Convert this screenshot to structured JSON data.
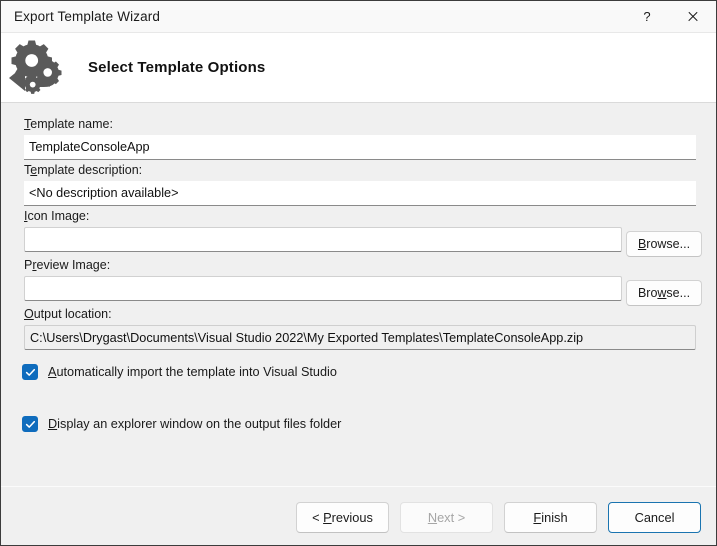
{
  "window": {
    "title": "Export Template Wizard",
    "help_button": "?",
    "close_button": "✕"
  },
  "header": {
    "icon": "export-template-gears-icon",
    "title": "Select Template Options"
  },
  "form": {
    "template_name": {
      "label_pre": "",
      "label_accel": "T",
      "label_post": "emplate name:",
      "value": "TemplateConsoleApp"
    },
    "template_description": {
      "label_pre": "T",
      "label_accel": "e",
      "label_post": "mplate description:",
      "value": "<No description available>"
    },
    "icon_image": {
      "label_pre": "",
      "label_accel": "I",
      "label_post": "con Image:",
      "value": "",
      "browse_pre": "",
      "browse_accel": "B",
      "browse_post": "rowse..."
    },
    "preview_image": {
      "label_pre": "P",
      "label_accel": "r",
      "label_post": "eview Image:",
      "value": "",
      "browse_pre": "Bro",
      "browse_accel": "w",
      "browse_post": "se..."
    },
    "output_location": {
      "label_pre": "",
      "label_accel": "O",
      "label_post": "utput location:",
      "value": "C:\\Users\\Drygast\\Documents\\Visual Studio 2022\\My Exported Templates\\TemplateConsoleApp.zip"
    }
  },
  "checkboxes": [
    {
      "name": "auto-import",
      "label_pre": "",
      "label_accel": "A",
      "label_post": "utomatically import the template into Visual Studio",
      "checked": true
    },
    {
      "name": "display-explorer",
      "label_pre": "",
      "label_accel": "D",
      "label_post": "isplay an explorer window on the output files folder",
      "checked": true
    }
  ],
  "footer": {
    "previous": {
      "pre": "< ",
      "accel": "P",
      "post": "revious",
      "enabled": true
    },
    "next": {
      "pre": "",
      "accel": "N",
      "post": "ext >",
      "enabled": false
    },
    "finish": {
      "pre": "",
      "accel": "F",
      "post": "inish",
      "enabled": true
    },
    "cancel": {
      "pre": "",
      "accel": "",
      "post": "Cancel",
      "enabled": true,
      "is_default": true
    }
  },
  "colors": {
    "accent": "#0f6cbd",
    "default_button_border": "#1a74b0",
    "titlebar_bg": "#f9f9f9",
    "body_bg": "#f0f0f0",
    "header_bg": "#ffffff"
  }
}
